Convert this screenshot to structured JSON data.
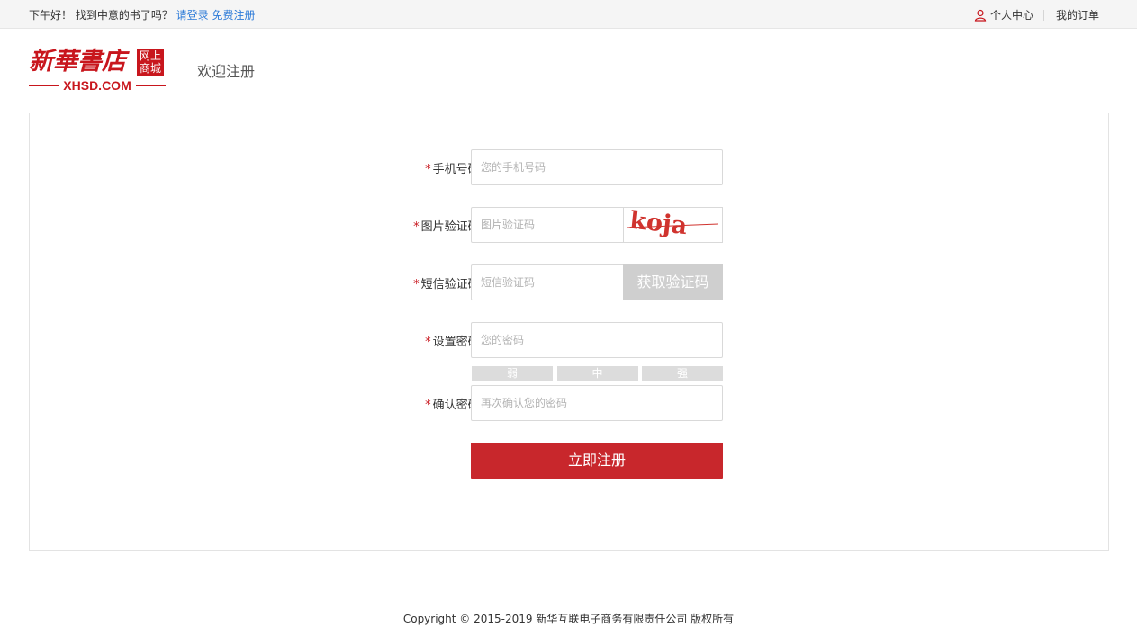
{
  "topbar": {
    "greeting": "下午好！ 找到中意的书了吗？",
    "login_link": "请登录",
    "register_link": "免费注册",
    "user_center": "个人中心",
    "my_orders": "我的订单"
  },
  "header": {
    "logo_calligraphy": "新華書店",
    "logo_badge_line1": "网上",
    "logo_badge_line2": "商城",
    "logo_domain": "XHSD.COM",
    "welcome": "欢迎注册"
  },
  "form": {
    "phone": {
      "label": "手机号码:",
      "placeholder": "您的手机号码",
      "value": ""
    },
    "image_code": {
      "label": "图片验证码:",
      "placeholder": "图片验证码",
      "value": "",
      "captcha_text": "koja"
    },
    "sms_code": {
      "label": "短信验证码:",
      "placeholder": "短信验证码",
      "value": "",
      "button": "获取验证码"
    },
    "password": {
      "label": "设置密码:",
      "placeholder": "您的密码",
      "value": ""
    },
    "strength": [
      "弱",
      "中",
      "强"
    ],
    "confirm": {
      "label": "确认密码:",
      "placeholder": "再次确认您的密码",
      "value": ""
    },
    "required_mark": "*",
    "submit": "立即注册"
  },
  "footer": {
    "copyright": "Copyright © 2015-2019 新华互联电子商务有限责任公司 版权所有"
  },
  "colors": {
    "brand_red": "#c8161d",
    "submit_red": "#c8272c",
    "link_blue": "#2d7bd8",
    "disabled_gray": "#cfcfcf"
  }
}
